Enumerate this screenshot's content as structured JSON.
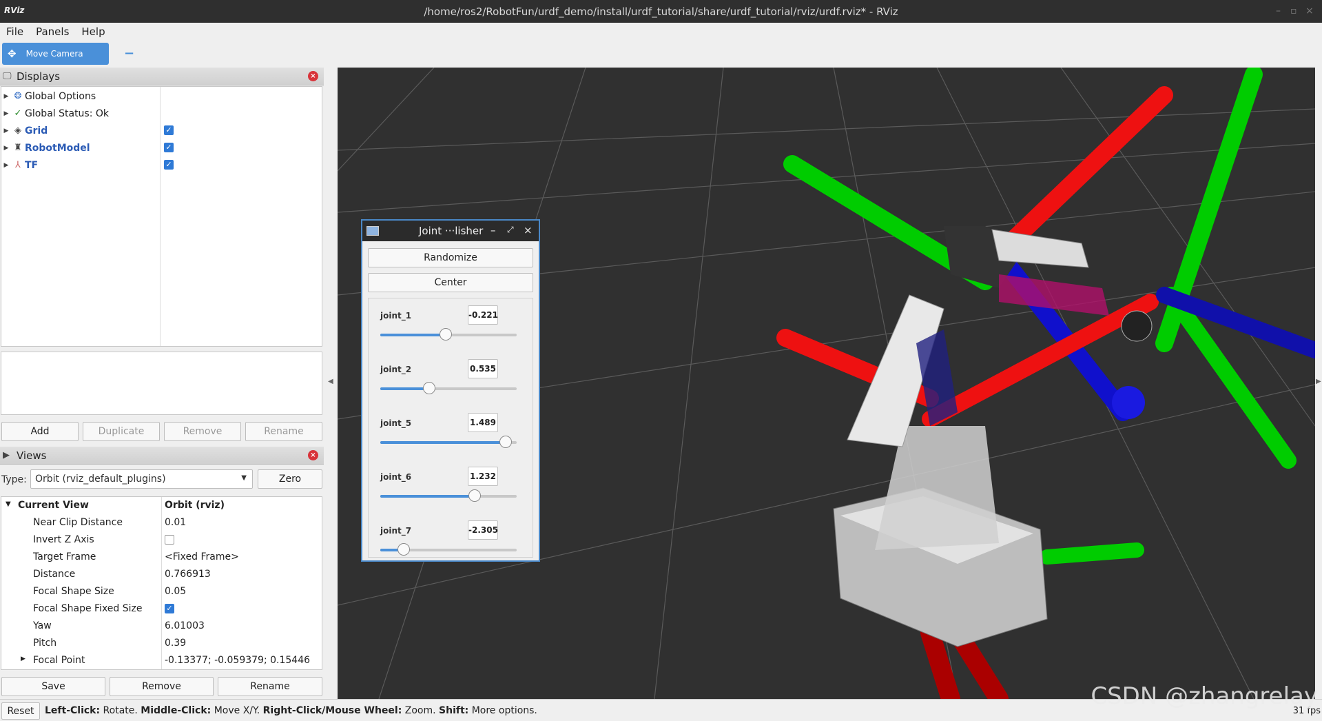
{
  "window": {
    "logo": "RViz",
    "title": "/home/ros2/RobotFun/urdf_demo/install/urdf_tutorial/share/urdf_tutorial/rviz/urdf.rviz* - RViz"
  },
  "menu": [
    "File",
    "Panels",
    "Help"
  ],
  "toolbar": {
    "move_camera": "Move Camera"
  },
  "displays": {
    "title": "Displays",
    "items": [
      {
        "label": "Global Options"
      },
      {
        "label": "Global Status: Ok"
      },
      {
        "label": "Grid",
        "checked": true
      },
      {
        "label": "RobotModel",
        "checked": true
      },
      {
        "label": "TF",
        "checked": true
      }
    ],
    "buttons": {
      "add": "Add",
      "duplicate": "Duplicate",
      "remove": "Remove",
      "rename": "Rename"
    }
  },
  "views": {
    "title": "Views",
    "type_label": "Type:",
    "type_value": "Orbit (rviz_default_plugins)",
    "zero": "Zero",
    "current_view": {
      "label": "Current View",
      "value": "Orbit (rviz)"
    },
    "props": [
      {
        "k": "Near Clip Distance",
        "v": "0.01"
      },
      {
        "k": "Invert Z Axis",
        "v": ""
      },
      {
        "k": "Target Frame",
        "v": "<Fixed Frame>"
      },
      {
        "k": "Distance",
        "v": "0.766913"
      },
      {
        "k": "Focal Shape Size",
        "v": "0.05"
      },
      {
        "k": "Focal Shape Fixed Size",
        "v": ""
      },
      {
        "k": "Yaw",
        "v": "6.01003"
      },
      {
        "k": "Pitch",
        "v": "0.39"
      },
      {
        "k": "Focal Point",
        "v": "-0.13377; -0.059379; 0.15446"
      }
    ],
    "buttons": {
      "save": "Save",
      "remove": "Remove",
      "rename": "Rename"
    }
  },
  "jsp": {
    "title": "Joint ···lisher",
    "randomize": "Randomize",
    "center": "Center",
    "joints": [
      {
        "name": "joint_1",
        "value": "-0.221",
        "pos": 0.48
      },
      {
        "name": "joint_2",
        "value": "0.535",
        "pos": 0.36
      },
      {
        "name": "joint_5",
        "value": "1.489",
        "pos": 0.92
      },
      {
        "name": "joint_6",
        "value": "1.232",
        "pos": 0.69
      },
      {
        "name": "joint_7",
        "value": "-2.305",
        "pos": 0.17
      }
    ]
  },
  "status": {
    "reset": "Reset",
    "parts": [
      {
        "b": "Left-Click:",
        "t": " Rotate. "
      },
      {
        "b": "Middle-Click:",
        "t": " Move X/Y. "
      },
      {
        "b": "Right-Click/Mouse Wheel:",
        "t": " Zoom. "
      },
      {
        "b": "Shift:",
        "t": " More options."
      }
    ],
    "fps": "31 fps"
  },
  "watermark": "CSDN @zhangrelay",
  "colors": {
    "accent": "#4a90d9",
    "x_axis": "#ff0000",
    "y_axis": "#00d000",
    "z_axis": "#0000ff",
    "viewport_bg": "#303030"
  }
}
